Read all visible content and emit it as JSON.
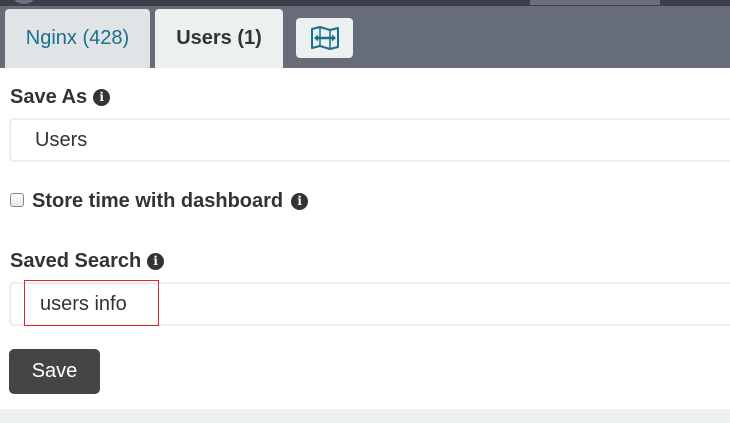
{
  "tabs": [
    {
      "label": "Nginx (428)",
      "active": false
    },
    {
      "label": "Users (1)",
      "active": true
    }
  ],
  "map_button": {
    "icon": "map-expand-icon"
  },
  "save_as": {
    "label": "Save As",
    "value": "Users"
  },
  "store_time": {
    "label": "Store time with dashboard",
    "checked": false
  },
  "saved_search": {
    "label": "Saved Search",
    "value": "users info"
  },
  "save_button": {
    "label": "Save"
  },
  "info_icon_glyph": "i",
  "colors": {
    "tab_bar": "#676c79",
    "active_tab_bg": "#ecf0f1",
    "inactive_tab_text": "#1b6f8a",
    "save_button_bg": "#454545",
    "highlight_border": "#e0262c"
  }
}
